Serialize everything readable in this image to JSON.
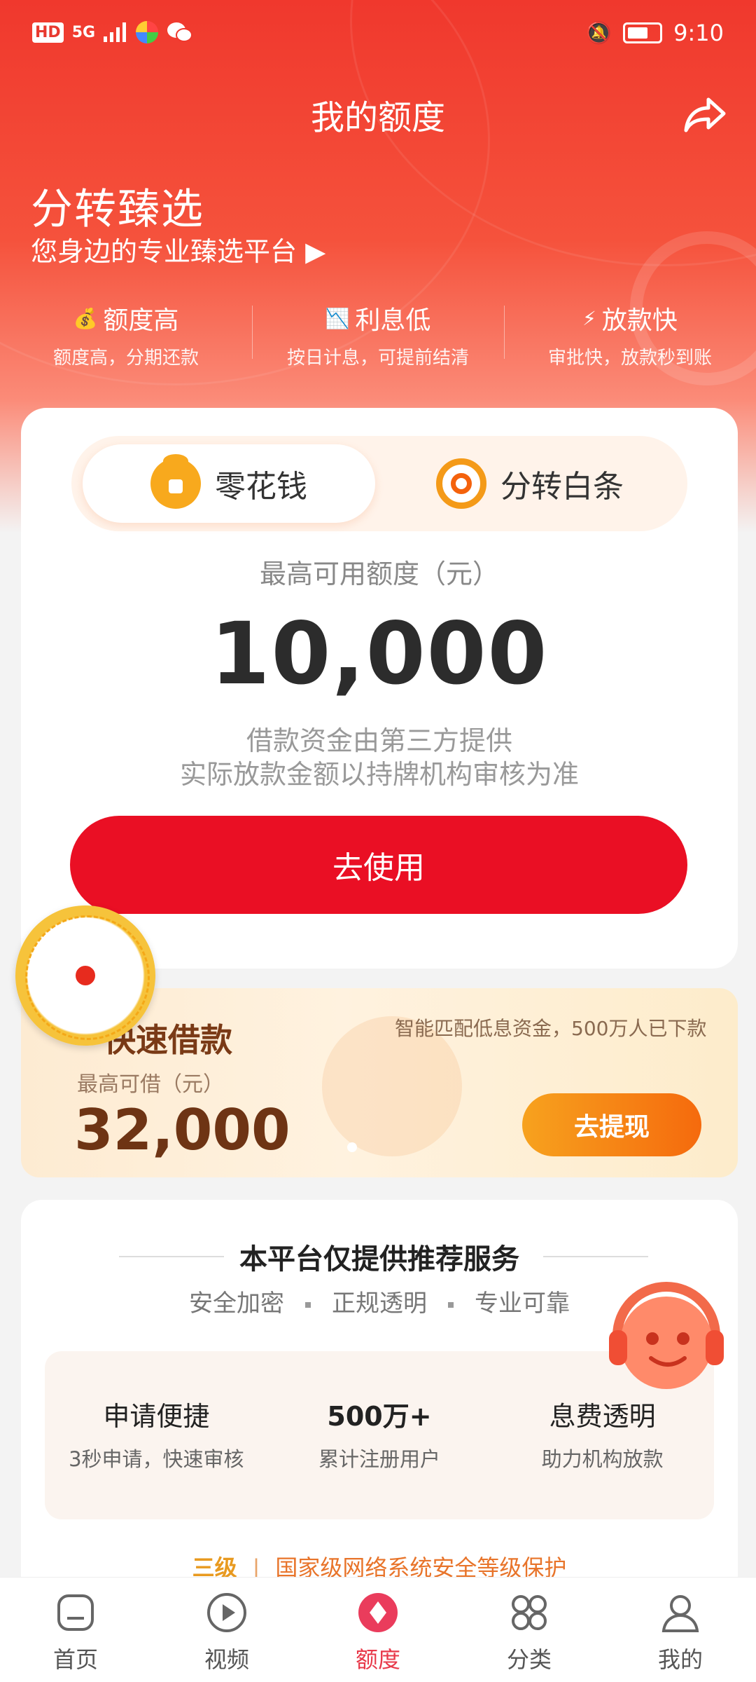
{
  "status_bar": {
    "hd": "HD",
    "signal": "5G",
    "time": "9:10"
  },
  "header": {
    "title": "我的额度"
  },
  "brand": {
    "title": "分转臻选",
    "subtitle": "您身边的专业臻选平台 ▶"
  },
  "features": [
    {
      "icon": "money-bag-icon",
      "glyph": "💰",
      "title": "额度高",
      "desc": "额度高，分期还款"
    },
    {
      "icon": "chart-icon",
      "glyph": "📉",
      "title": "利息低",
      "desc": "按日计息，可提前结清"
    },
    {
      "icon": "lightning-icon",
      "glyph": "⚡",
      "title": "放款快",
      "desc": "审批快，放款秒到账"
    }
  ],
  "quota_card": {
    "tabs": [
      {
        "label": "零花钱"
      },
      {
        "label": "分转白条"
      }
    ],
    "label": "最高可用额度（元）",
    "amount": "10,000",
    "note_line1": "借款资金由第三方提供",
    "note_line2": "实际放款金额以持牌机构审核为准",
    "button": "去使用"
  },
  "quick_loan": {
    "title": "快速借款",
    "tagline": "智能匹配低息资金，500万人已下款",
    "label": "最高可借（元）",
    "amount": "32,000",
    "button": "去提现"
  },
  "platform": {
    "heading": "本平台仅提供推荐服务",
    "tags": [
      "安全加密",
      "正规透明",
      "专业可靠"
    ],
    "benefits": [
      {
        "title": "申请便捷",
        "desc": "3秒申请，快速审核"
      },
      {
        "title": "500万+",
        "desc": "累计注册用户"
      },
      {
        "title": "息费透明",
        "desc": "助力机构放款"
      }
    ],
    "security_level": "三级",
    "security_separator": "|",
    "security_text": "国家级网络系统安全等级保护"
  },
  "tabbar": [
    {
      "label": "首页",
      "icon": "home-icon"
    },
    {
      "label": "视频",
      "icon": "video-icon"
    },
    {
      "label": "额度",
      "icon": "quota-icon",
      "active": true
    },
    {
      "label": "分类",
      "icon": "category-icon"
    },
    {
      "label": "我的",
      "icon": "profile-icon"
    }
  ],
  "colors": {
    "primary_red": "#ea0f24",
    "active_tab": "#e8394a",
    "orange_button": "#f56a0d"
  }
}
